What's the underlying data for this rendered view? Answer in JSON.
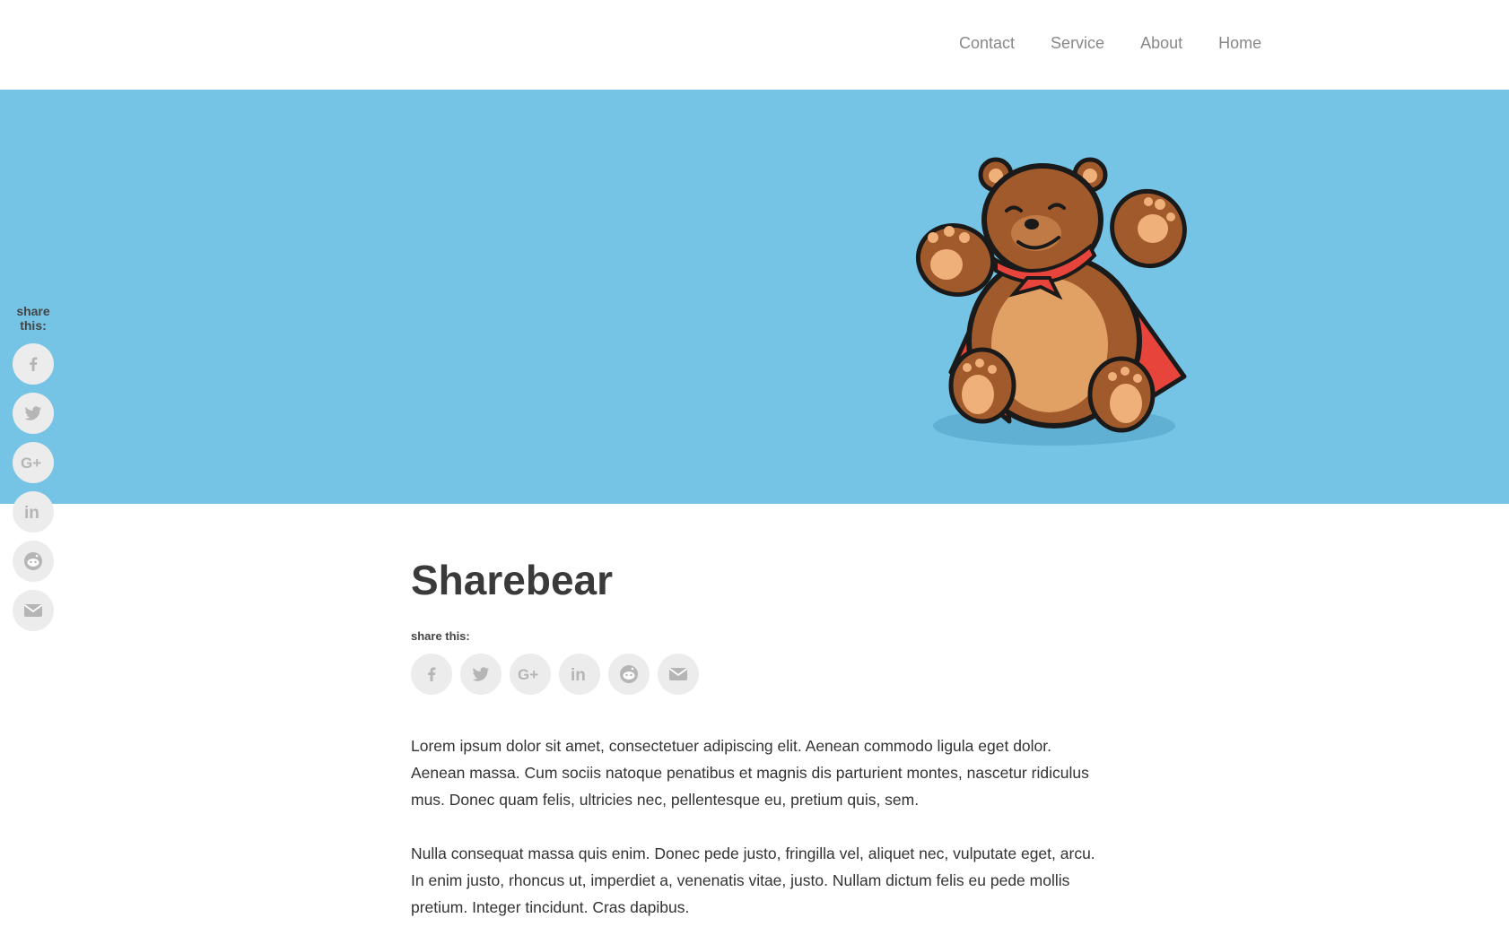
{
  "nav": {
    "items": [
      {
        "label": "Contact"
      },
      {
        "label": "Service"
      },
      {
        "label": "About"
      },
      {
        "label": "Home"
      }
    ]
  },
  "hero": {
    "background": "#75c4e6",
    "illustration": "teddy-bear-with-red-cape"
  },
  "floating_share": {
    "label": "share this:",
    "buttons": [
      "facebook-icon",
      "twitter-icon",
      "google-plus-icon",
      "linkedin-icon",
      "reddit-icon",
      "email-icon"
    ]
  },
  "article": {
    "title": "Sharebear",
    "share_label": "share this:",
    "share_buttons": [
      "facebook-icon",
      "twitter-icon",
      "google-plus-icon",
      "linkedin-icon",
      "reddit-icon",
      "email-icon"
    ],
    "paragraphs": [
      "Lorem ipsum dolor sit amet, consectetuer adipiscing elit. Aenean commodo ligula eget dolor. Aenean massa. Cum sociis natoque penatibus et magnis dis parturient montes, nascetur ridiculus mus. Donec quam felis, ultricies nec, pellentesque eu, pretium quis, sem.",
      "Nulla consequat massa quis enim. Donec pede justo, fringilla vel, aliquet nec, vulputate eget, arcu. In enim justo, rhoncus ut, imperdiet a, venenatis vitae, justo. Nullam dictum felis eu pede mollis pretium. Integer tincidunt. Cras dapibus."
    ]
  },
  "colors": {
    "icon_bg": "#ececec",
    "icon_fg": "#b5b5b5",
    "nav_text": "#888888"
  }
}
